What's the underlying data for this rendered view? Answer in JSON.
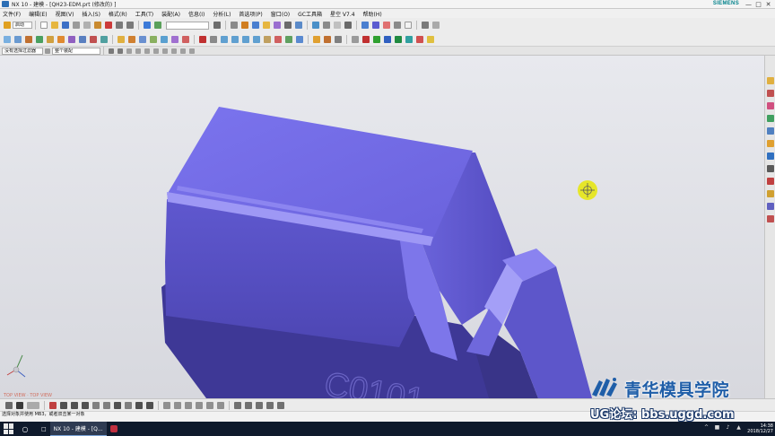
{
  "window": {
    "title": "NX 10 - 建模 - [QH23-EDM.prt  (修改的) ]",
    "brand": "SIEMENS",
    "controls": {
      "minimize": "—",
      "maximize": "□",
      "close": "✕"
    }
  },
  "menu": {
    "items": [
      "文件(F)",
      "编辑(E)",
      "视图(V)",
      "插入(S)",
      "格式(R)",
      "工具(T)",
      "装配(A)",
      "信息(I)",
      "分析(L)",
      "首选项(P)",
      "窗口(O)",
      "GC工具箱",
      "星空 V7.4",
      "帮助(H)"
    ]
  },
  "toolbar": {
    "start_label": "启动",
    "search_placeholder": "",
    "select_filter": "没有选择过滤器",
    "assembly_scope": "整个装配"
  },
  "viewport": {
    "view_label": "TOP VIEW · TOP VIEW",
    "engraving": "C0101"
  },
  "status": {
    "line1": "选择对象并使用 MB3，或者双击某一对象",
    "line2": ""
  },
  "taskbar": {
    "apps": [
      {
        "label": "NX 10 - 建模 - [Q...",
        "active": true
      },
      {
        "label": "",
        "active": false
      }
    ],
    "time": "14:38",
    "date": "2018/12/27"
  },
  "watermark": {
    "name": "青华模具学院",
    "bbs": "UG论坛: bbs.uggd.com"
  },
  "colors": {
    "model": "#6b63d9",
    "viewport": "#dfe0e6",
    "brand": "#00818a",
    "taskbar": "#0f1a2c",
    "watermark": "#1f5ea8"
  }
}
